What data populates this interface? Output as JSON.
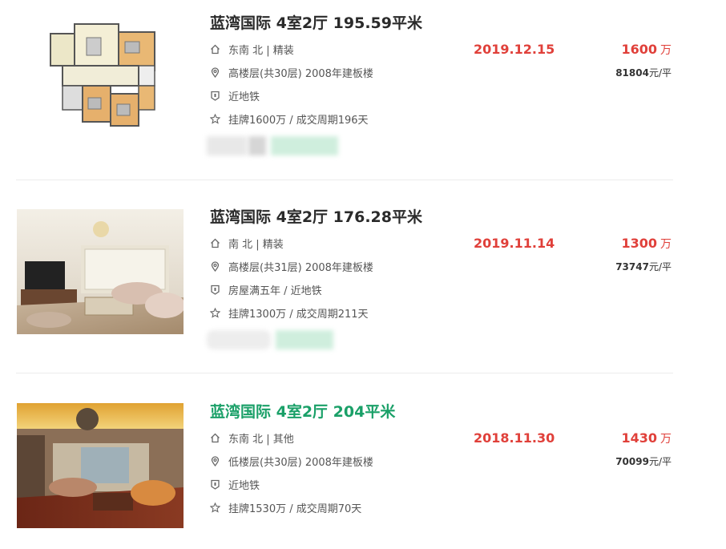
{
  "listings": [
    {
      "title": "蓝湾国际 4室2厅 195.59平米",
      "orientation": "东南 北 | 精装",
      "floor": "高楼层(共30层) 2008年建板楼",
      "tag": "近地铁",
      "listing_info": "挂牌1600万 / 成交周期196天",
      "deal_date": "2019.12.15",
      "total_price": "1600",
      "price_unit": "万",
      "unit_price_value": "81804",
      "unit_price_suffix": "元/平",
      "image": "floor-plan"
    },
    {
      "title": "蓝湾国际 4室2厅 176.28平米",
      "orientation": "南 北 | 精装",
      "floor": "高楼层(共31层) 2008年建板楼",
      "tag": "房屋满五年 / 近地铁",
      "listing_info": "挂牌1300万 / 成交周期211天",
      "deal_date": "2019.11.14",
      "total_price": "1300",
      "price_unit": "万",
      "unit_price_value": "73747",
      "unit_price_suffix": "元/平",
      "image": "living-room-photo"
    },
    {
      "title": "蓝湾国际 4室2厅 204平米",
      "orientation": "东南 北 | 其他",
      "floor": "低楼层(共30层) 2008年建板楼",
      "tag": "近地铁",
      "listing_info": "挂牌1530万 / 成交周期70天",
      "deal_date": "2018.11.30",
      "total_price": "1430",
      "price_unit": "万",
      "unit_price_value": "70099",
      "unit_price_suffix": "元/平",
      "image": "living-room-photo",
      "hovered": true
    }
  ],
  "icons": [
    "house-icon",
    "location-icon",
    "shield-icon",
    "star-icon"
  ],
  "colors": {
    "price": "#e0403a",
    "title_hover": "#1aa068",
    "title": "#2a2a2a"
  }
}
